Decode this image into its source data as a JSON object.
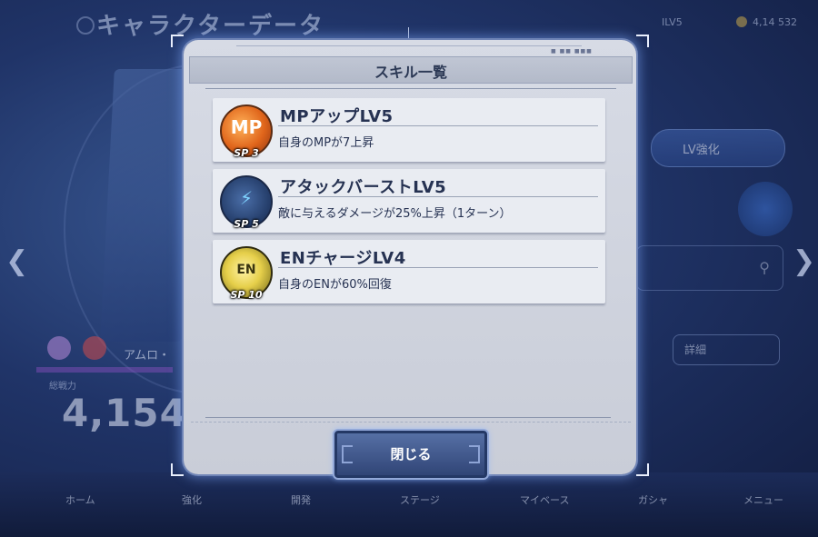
{
  "background": {
    "screen_title": "キャラクターデータ",
    "level_badge": "ILV5",
    "coins": "4,14 532",
    "lv_button": "LV強化",
    "detail_button": "詳細",
    "character_name": "アムロ・",
    "power_label": "総戦力",
    "power_value": "4,154",
    "nav": [
      "ホーム",
      "強化",
      "開発",
      "ステージ",
      "マイベース",
      "ガシャ",
      "メニュー"
    ]
  },
  "modal": {
    "title": "スキル一覧",
    "skills": [
      {
        "name": "MPアップLV5",
        "description": "自身のMPが7上昇",
        "icon": "mp-up-icon",
        "icon_text": "MP",
        "sp": "SP 3",
        "color": "#e0651b"
      },
      {
        "name": "アタックバーストLV5",
        "description": "敵に与えるダメージが25%上昇（1ターン）",
        "icon": "lightning-icon",
        "icon_text": "⚡",
        "sp": "SP 5",
        "color": "#263f6c"
      },
      {
        "name": "ENチャージLV4",
        "description": "自身のENが60%回復",
        "icon": "en-battery-icon",
        "icon_text": "EN",
        "sp": "SP 10",
        "color": "#e6cf4a"
      }
    ],
    "close_button": "閉じる"
  }
}
